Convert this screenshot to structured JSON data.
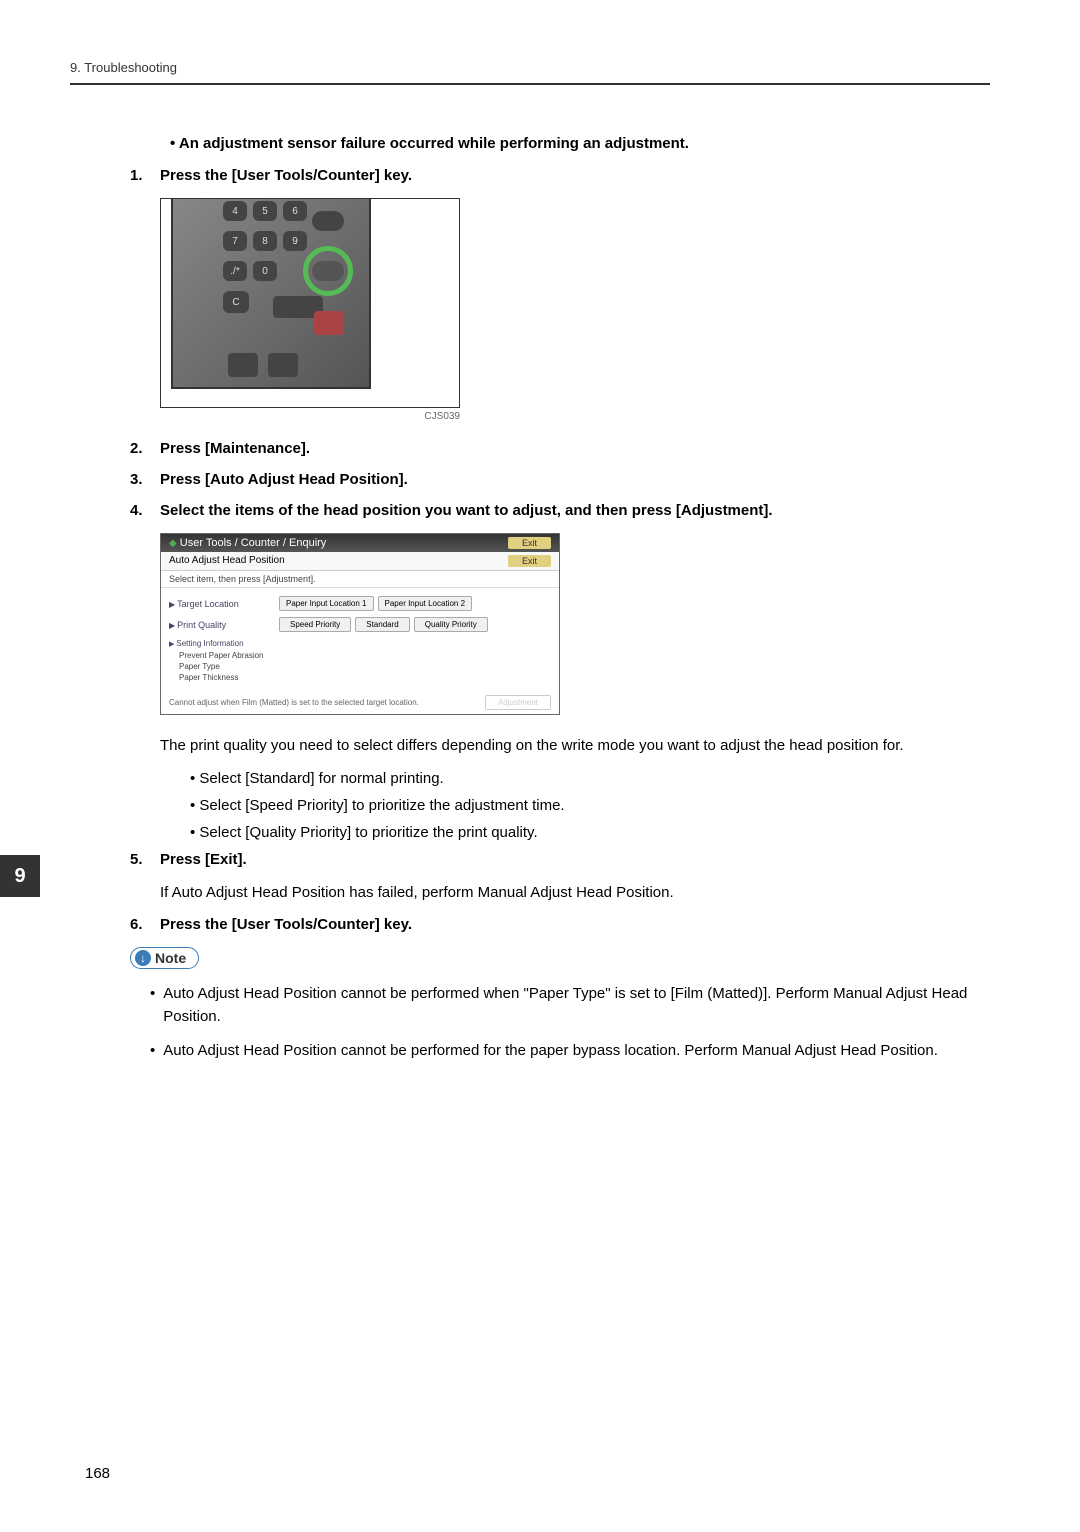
{
  "header": "9. Troubleshooting",
  "intro_bullet": "An adjustment sensor failure occurred while performing an adjustment.",
  "steps": {
    "s1": {
      "num": "1.",
      "text": "Press the [User Tools/Counter] key."
    },
    "s2": {
      "num": "2.",
      "text": "Press [Maintenance]."
    },
    "s3": {
      "num": "3.",
      "text": "Press [Auto Adjust Head Position]."
    },
    "s4": {
      "num": "4.",
      "text": "Select the items of the head position you want to adjust, and then press [Adjustment]."
    },
    "s5": {
      "num": "5.",
      "text": "Press [Exit]."
    },
    "s6": {
      "num": "6.",
      "text": "Press the [User Tools/Counter] key."
    }
  },
  "keypad": {
    "b4": "4",
    "b5": "5",
    "b6": "6",
    "b7": "7",
    "b8": "8",
    "b9": "9",
    "bstar": "./*",
    "b0": "0",
    "bc": "C",
    "label": "CJS039"
  },
  "dialog": {
    "title": "User Tools / Counter / Enquiry",
    "exit": "Exit",
    "subtitle": "Auto Adjust Head Position",
    "instruction": "Select item, then press [Adjustment].",
    "target_location": "Target Location",
    "pil1": "Paper Input Location 1",
    "pil2": "Paper Input Location 2",
    "print_quality": "Print Quality",
    "speed": "Speed Priority",
    "standard": "Standard",
    "quality": "Quality Priority",
    "setting_info": "Setting Information",
    "prevent": "Prevent Paper Abrasion",
    "paper_type": "Paper Type",
    "paper_thickness": "Paper Thickness",
    "footer_text": "Cannot adjust when Film (Matted) is set to the selected target location.",
    "adjustment": "Adjustment"
  },
  "post_dialog_text": "The print quality you need to select differs depending on the write mode you want to adjust the head position for.",
  "bullets": {
    "b1": "Select [Standard] for normal printing.",
    "b2": "Select [Speed Priority] to prioritize the adjustment time.",
    "b3": "Select [Quality Priority] to prioritize the print quality."
  },
  "step5_body": "If Auto Adjust Head Position has failed, perform Manual Adjust Head Position.",
  "note_label": "Note",
  "notes": {
    "n1": "Auto Adjust Head Position cannot be performed when \"Paper Type\" is set to [Film (Matted)]. Perform Manual Adjust Head Position.",
    "n2": "Auto Adjust Head Position cannot be performed for the paper bypass location. Perform Manual Adjust Head Position."
  },
  "side_tab": "9",
  "page_num": "168"
}
